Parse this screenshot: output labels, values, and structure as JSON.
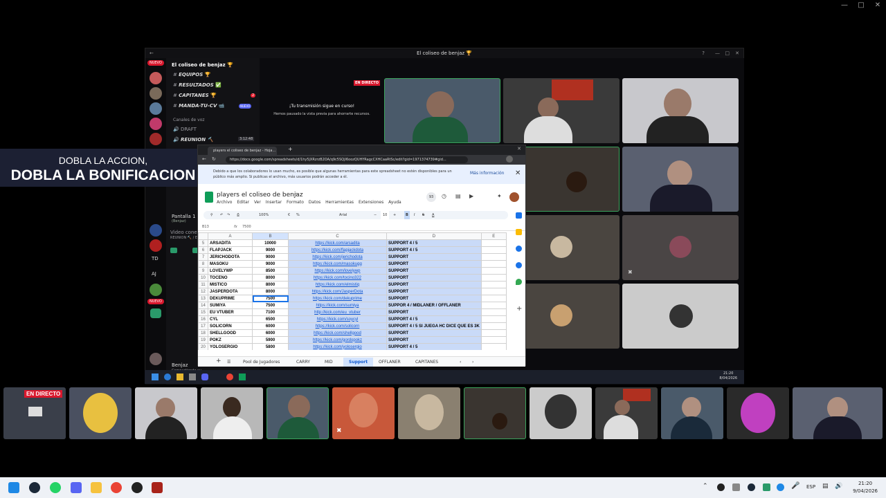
{
  "discord": {
    "window_title": "El coliseo de benjaz 🏆",
    "server_name": "El coliseo de benjaz 🏆",
    "channels": [
      {
        "name": "EQUIPOS",
        "emoji": "🏆"
      },
      {
        "name": "RESULTADOS",
        "emoji": "✅"
      },
      {
        "name": "CAPITANES",
        "emoji": "🏆",
        "badge": "2"
      },
      {
        "name": "MANDA-TU-CV",
        "emoji": "📹",
        "badge": "NUEVO"
      }
    ],
    "voice_category": "Canales de voz",
    "voice_channels": [
      "DRAFT",
      "REUNION 🔨"
    ],
    "reunion_time": "3:12:48",
    "new_badge": "NUEVO",
    "server_labels": [
      "TD",
      "AJ"
    ],
    "user_name": "Benjaz",
    "user_status": "Compartiendo su...",
    "screen_share_label": "Pantalla 1",
    "screen_share_sub": "(Benjaz)",
    "video_connected": "Video conectado",
    "video_connected_sub": "REUNION 🔨 / El co...",
    "stream_notice_title": "¡Tu transmisión sigue en curso!",
    "stream_notice_body": "Hemos pausado la vista previa para ahorrarte recursos.",
    "live_label": "EN DIRECTO"
  },
  "banner": {
    "line1": "DOBLA LA ACCION,",
    "line2": "DOBLA LA BONIFICACION"
  },
  "browser": {
    "tab_title": "players el coliseo de benjaz - Hoja...",
    "url": "https://docs.google.com/spreadsheets/d/1hy5jXRzrzB2OA/q9c5SQjI6oozQUHYRagcCXHCaaRtSc/edit?gid=1971374739#gid...",
    "notice": "Debido a que los colaboradores lo usan mucho, es posible que algunas herramientas para este spreadsheet no estén disponibles para un público más amplio. Si publicas el archivo, más usuarios podrán acceder a él.",
    "notice_link": "Más información",
    "sheet_title": "players el coliseo de benjaz",
    "menu": [
      "Archivo",
      "Editar",
      "Ver",
      "Insertar",
      "Formato",
      "Datos",
      "Herramientas",
      "Extensiones",
      "Ayuda"
    ],
    "zoom": "100%",
    "font": "Arial",
    "font_size": "10",
    "cell_ref": "B13",
    "formula_value": "7500",
    "col_headers": [
      "A",
      "B",
      "C",
      "D",
      "E"
    ],
    "rows": [
      {
        "n": "5",
        "name": "ARSADITA",
        "mmr": "10000",
        "link": "https://kick.com/arsadita",
        "role": "SUPPORT 4 / 5"
      },
      {
        "n": "6",
        "name": "FLAPJACK",
        "mmr": "9000",
        "link": "https://kick.com/flapjackdota",
        "role": "SUPPORT 4 / 5"
      },
      {
        "n": "7",
        "name": "JERICHODOTA",
        "mmr": "9000",
        "link": "https://kick.com/jerichodota",
        "role": "SUPPORT"
      },
      {
        "n": "8",
        "name": "MASOKU",
        "mmr": "9000",
        "link": "https://kick.com/masokugg",
        "role": "SUPPORT"
      },
      {
        "n": "9",
        "name": "LOVELYWP",
        "mmr": "8500",
        "link": "https://kick.com/lovelywp",
        "role": "SUPPORT"
      },
      {
        "n": "10",
        "name": "TOCENO",
        "mmr": "8000",
        "link": "https://kick.com/tocino322",
        "role": "SUPPORT"
      },
      {
        "n": "11",
        "name": "MISTICO",
        "mmr": "8000",
        "link": "https://kick.com/elmistiq",
        "role": "SUPPORT"
      },
      {
        "n": "12",
        "name": "JASPERDOTA",
        "mmr": "8000",
        "link": "https://kick.com/JasperDota",
        "role": "SUPPORT"
      },
      {
        "n": "13",
        "name": "DEKUPRIME",
        "mmr": "7500",
        "link": "https://kick.com/dekuprime",
        "role": "SUPPORT"
      },
      {
        "n": "14",
        "name": "SUMIYA",
        "mmr": "7500",
        "link": "https://kick.com/sumiya",
        "role": "SUPPOR 4 / MIDLANER / OFFLANER"
      },
      {
        "n": "15",
        "name": "EU VTUBER",
        "mmr": "7100",
        "link": "http://kick.com/eu_vtuber",
        "role": "SUPPORT"
      },
      {
        "n": "16",
        "name": "CYL",
        "mmr": "6500",
        "link": "https://kick.com/soycyl",
        "role": "SUPPORT 4 / 5"
      },
      {
        "n": "17",
        "name": "SOLICORN",
        "mmr": "6000",
        "link": "https://kick.com/solicorn",
        "role": "SUPPORT 4 / 5 SI JUEGA HC DICE QUE ES 3K"
      },
      {
        "n": "18",
        "name": "SHELLGOOD",
        "mmr": "6000",
        "link": "https://kick.com/shellgood",
        "role": "SUPPORT"
      },
      {
        "n": "19",
        "name": "POKZ",
        "mmr": "5900",
        "link": "https://kick.com/gordopokz",
        "role": "SUPPORT"
      },
      {
        "n": "20",
        "name": "YOLOSERGIO",
        "mmr": "5800",
        "link": "https://kick.com/yolosergio",
        "role": "SUPPORT 4 / 5"
      },
      {
        "n": "21",
        "name": "ARLEMA10",
        "mmr": "5700",
        "link": "https://kick.com/arlema10",
        "role": "SUPPORT"
      }
    ],
    "sheet_tabs": [
      "Pool de Jugadores",
      "CARRY",
      "MID",
      "Support",
      "OFFLANER",
      "CAPITANES"
    ],
    "active_tab": "Support"
  },
  "inner_taskbar": {
    "time": "21:20",
    "date": "8/04/2026"
  },
  "taskbar": {
    "lang": "ESP",
    "time": "21:20",
    "date": "9/04/2026"
  },
  "colors": {
    "live_red": "#d9182d",
    "discord_bg": "#0f0f12",
    "sheet_selection": "#c9daf8",
    "banner_bg": "#1c2033"
  }
}
